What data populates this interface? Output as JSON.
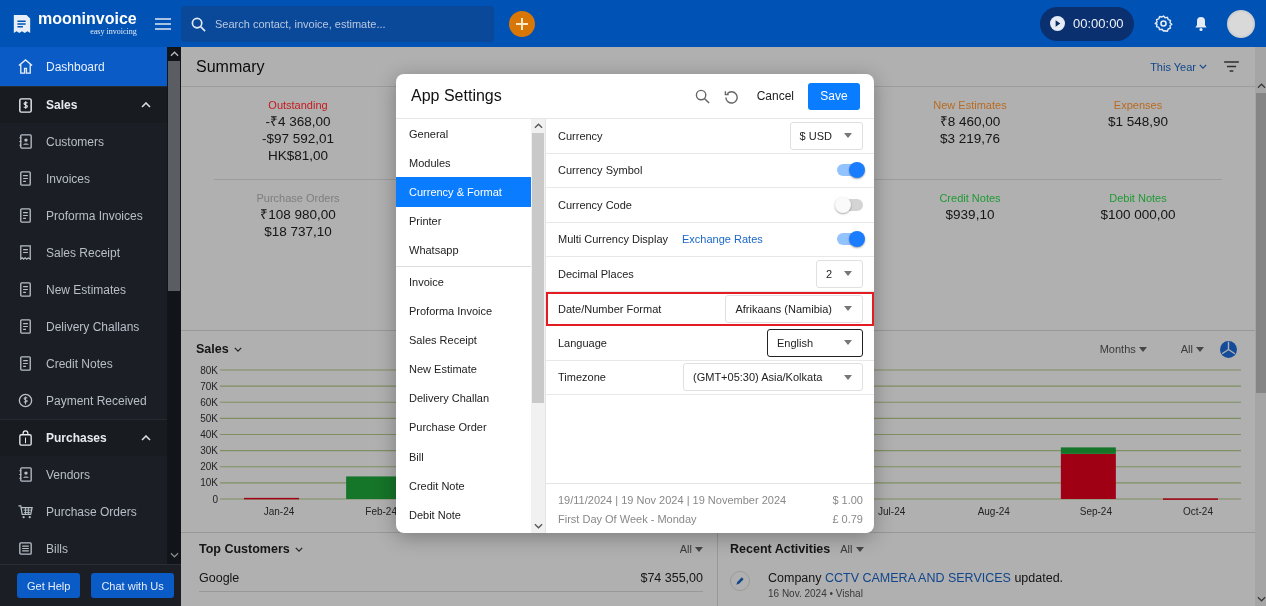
{
  "topbar": {
    "logo": {
      "name": "mooninvoice",
      "tagline": "easy invoicing"
    },
    "search": {
      "placeholder": "Search contact, invoice, estimate..."
    },
    "timer": "00:00:00"
  },
  "sidebar": {
    "items": [
      {
        "label": "Dashboard",
        "selected": true
      },
      {
        "label": "Sales",
        "selected": false,
        "expanded": true,
        "children": [
          {
            "label": "Customers",
            "selected": false
          },
          {
            "label": "Invoices",
            "selected": false
          },
          {
            "label": "Proforma Invoices",
            "selected": false
          },
          {
            "label": "Sales Receipt",
            "selected": false
          },
          {
            "label": "New Estimates",
            "selected": false
          },
          {
            "label": "Delivery Challans",
            "selected": false
          },
          {
            "label": "Credit Notes",
            "selected": false
          },
          {
            "label": "Payment Received",
            "selected": false
          }
        ]
      },
      {
        "label": "Purchases",
        "selected": false,
        "expanded": true,
        "children": [
          {
            "label": "Vendors",
            "selected": false
          },
          {
            "label": "Purchase Orders",
            "selected": false
          },
          {
            "label": "Bills",
            "selected": false
          }
        ]
      }
    ],
    "buttons": [
      "Get Help",
      "Chat with Us"
    ]
  },
  "summary": {
    "title": "Summary",
    "period": "This Year",
    "stat_rows": [
      [
        {
          "label": "Outstanding",
          "color": "#c41a1e",
          "values": [
            "-₹4 368,00",
            "-$97 592,01",
            "HK$81,00"
          ]
        },
        {
          "label": "New Estimates",
          "color": "#b86b22",
          "values": [
            "₹8 460,00",
            "$3 219,76"
          ]
        },
        {
          "label": "Expenses",
          "color": "#b86b22",
          "values": [
            "$1 548,90"
          ]
        }
      ],
      [
        {
          "label": "Purchase Orders",
          "color": "#7e7e7e",
          "values": [
            "₹108 980,00",
            "$18 737,10"
          ]
        },
        {
          "label": "Credit Notes",
          "color": "#1f9a33",
          "values": [
            "$939,10"
          ]
        },
        {
          "label": "Debit Notes",
          "color": "#1f9a33",
          "values": [
            "$100 000,00"
          ]
        }
      ]
    ]
  },
  "sales": {
    "title": "Sales",
    "period": "Months",
    "filter": "All",
    "chart_data": {
      "type": "bar",
      "stacked": true,
      "grid": true,
      "categories": [
        "Jan-24",
        "Feb-24",
        null,
        null,
        null,
        null,
        "Jul-24",
        "Aug-24",
        "Sep-24",
        "Oct-24"
      ],
      "ylim": [
        0,
        80000
      ],
      "yticks": [
        {
          "value": 0,
          "label": "0"
        },
        {
          "value": 10000,
          "label": "10K"
        },
        {
          "value": 20000,
          "label": "20K"
        },
        {
          "value": 30000,
          "label": "30K"
        },
        {
          "value": 40000,
          "label": "40K"
        },
        {
          "value": 50000,
          "label": "50K"
        },
        {
          "value": 60000,
          "label": "60K"
        },
        {
          "value": 70000,
          "label": "70K"
        },
        {
          "value": 80000,
          "label": "80K"
        }
      ],
      "series": [
        {
          "color": "#e8001c",
          "values": [
            700,
            0,
            null,
            null,
            null,
            null,
            0,
            0,
            28000,
            400
          ]
        },
        {
          "color": "#1faa3a",
          "values": [
            0,
            14000,
            null,
            null,
            null,
            null,
            0,
            0,
            4000,
            0
          ]
        }
      ]
    }
  },
  "top_customers": {
    "title": "Top Customers",
    "filter": "All",
    "rows": [
      {
        "name": "Google",
        "amount": "$74 355,00"
      }
    ]
  },
  "recent_activities": {
    "title": "Recent Activities",
    "filter": "All",
    "items": [
      {
        "before": "Company",
        "link": "CCTV CAMERA AND SERVICES",
        "after": "updated.",
        "meta": "16 Nov. 2024 • Vishal"
      }
    ]
  },
  "settings_dialog": {
    "title": "App Settings",
    "cancel": "Cancel",
    "save": "Save",
    "nav_groups": [
      [
        {
          "label": "General",
          "selected": false
        },
        {
          "label": "Modules",
          "selected": false
        },
        {
          "label": "Currency & Format",
          "selected": true
        },
        {
          "label": "Printer",
          "selected": false
        },
        {
          "label": "Whatsapp",
          "selected": false
        }
      ],
      [
        {
          "label": "Invoice",
          "selected": false
        },
        {
          "label": "Proforma Invoice",
          "selected": false
        },
        {
          "label": "Sales Receipt",
          "selected": false
        },
        {
          "label": "New Estimate",
          "selected": false
        },
        {
          "label": "Delivery Challan",
          "selected": false
        },
        {
          "label": "Purchase Order",
          "selected": false
        },
        {
          "label": "Bill",
          "selected": false
        },
        {
          "label": "Credit Note",
          "selected": false
        },
        {
          "label": "Debit Note",
          "selected": false
        }
      ]
    ],
    "rows": [
      {
        "kind": "select",
        "label": "Currency",
        "value": "$ USD",
        "highlighted": false,
        "focused": false
      },
      {
        "kind": "toggle",
        "label": "Currency Symbol",
        "on": true
      },
      {
        "kind": "toggle",
        "label": "Currency Code",
        "on": false
      },
      {
        "kind": "toggle",
        "label": "Multi Currency Display",
        "link": "Exchange Rates",
        "on": true
      },
      {
        "kind": "select",
        "label": "Decimal Places",
        "value": "2",
        "highlighted": false,
        "focused": false
      },
      {
        "kind": "select",
        "label": "Date/Number Format",
        "value": "Afrikaans (Namibia)",
        "highlighted": true,
        "focused": false
      },
      {
        "kind": "select",
        "label": "Language",
        "value": "English",
        "highlighted": false,
        "focused": true
      },
      {
        "kind": "select",
        "label": "Timezone",
        "value": "(GMT+05:30) Asia/Kolkata",
        "highlighted": false,
        "focused": false
      }
    ],
    "preview": [
      {
        "left": "19/11/2024 | 19 Nov 2024 | 19 November 2024",
        "right": "$ 1.00"
      },
      {
        "left": "First Day Of Week - Monday",
        "right": "£ 0.79"
      }
    ]
  }
}
